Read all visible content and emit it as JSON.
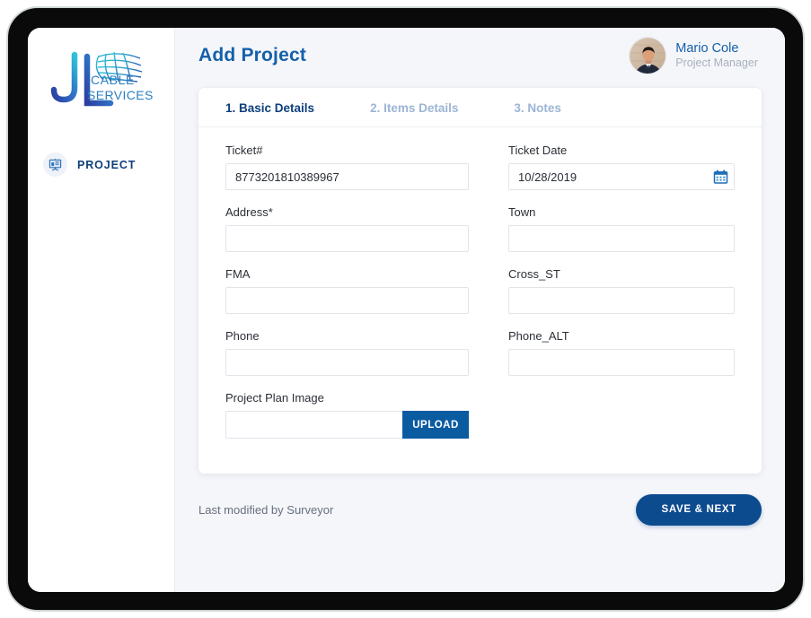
{
  "brand": {
    "logo_initials": "JL",
    "logo_line1": "CABLE",
    "logo_line2": "SERVICES",
    "logo_alt": "JL Cable Services"
  },
  "sidebar": {
    "items": [
      {
        "label": "PROJECT",
        "icon": "project-board-icon",
        "active": true
      }
    ]
  },
  "header": {
    "title": "Add Project",
    "user": {
      "name": "Mario Cole",
      "role": "Project Manager",
      "avatar_alt": "Mario Cole avatar"
    }
  },
  "tabs": [
    {
      "label": "1. Basic Details",
      "active": true
    },
    {
      "label": "2. Items Details",
      "active": false
    },
    {
      "label": "3. Notes",
      "active": false
    }
  ],
  "form": {
    "ticket_number": {
      "label": "Ticket#",
      "value": "8773201810389967",
      "placeholder": ""
    },
    "ticket_date": {
      "label": "Ticket Date",
      "value": "10/28/2019",
      "placeholder": "",
      "icon": "calendar-icon"
    },
    "address": {
      "label": "Address*",
      "value": "",
      "placeholder": ""
    },
    "town": {
      "label": "Town",
      "value": "",
      "placeholder": ""
    },
    "fma": {
      "label": "FMA",
      "value": "",
      "placeholder": ""
    },
    "cross_st": {
      "label": "Cross_ST",
      "value": "",
      "placeholder": ""
    },
    "phone": {
      "label": "Phone",
      "value": "",
      "placeholder": ""
    },
    "phone_alt": {
      "label": "Phone_ALT",
      "value": "",
      "placeholder": ""
    },
    "project_plan_image": {
      "label": "Project Plan Image",
      "value": "",
      "placeholder": "",
      "upload_label": "UPLOAD"
    }
  },
  "footer": {
    "last_modified": "Last modified by Surveyor",
    "save_next_label": "SAVE & NEXT"
  },
  "colors": {
    "brand_blue": "#1460aa",
    "tab_active": "#0d3f7d",
    "tab_inactive": "#9cb5d4",
    "upload_blue": "#0b5ba1",
    "save_blue": "#0d4b8f",
    "page_bg": "#f5f6fa",
    "card_bg": "#ffffff"
  }
}
